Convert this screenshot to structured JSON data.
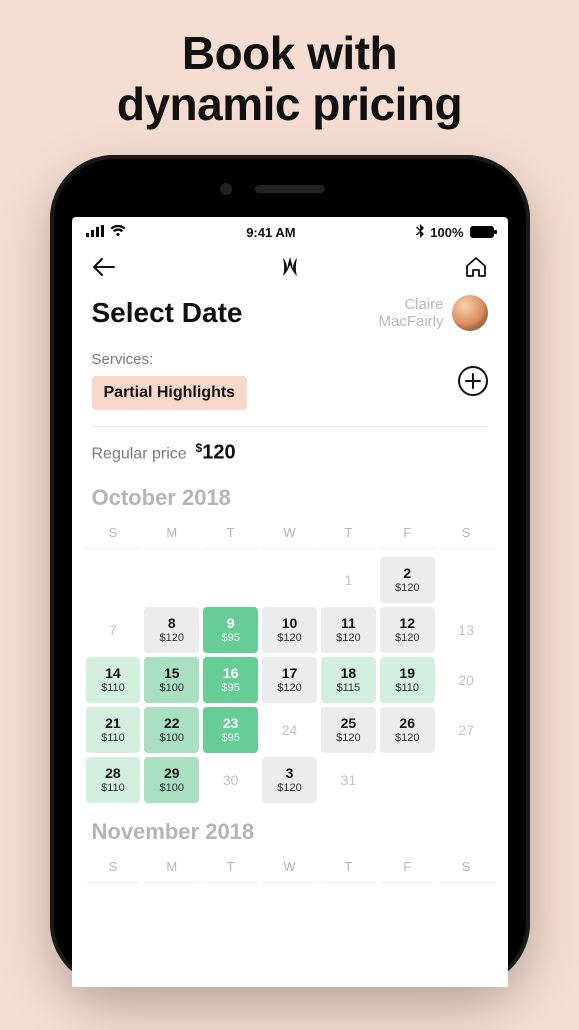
{
  "promo": {
    "line1": "Book with",
    "line2": "dynamic pricing"
  },
  "statusbar": {
    "time": "9:41 AM",
    "battery_pct": "100%"
  },
  "page": {
    "title": "Select Date",
    "user_first": "Claire",
    "user_last": "MacFairly"
  },
  "services": {
    "label": "Services:",
    "chip": "Partial Highlights"
  },
  "price": {
    "label": "Regular price",
    "currency": "$",
    "amount": "120"
  },
  "dow": [
    "S",
    "M",
    "T",
    "W",
    "T",
    "F",
    "S"
  ],
  "months": {
    "oct": {
      "title": "October 2018"
    },
    "nov": {
      "title": "November 2018"
    }
  },
  "oct_grid": [
    {
      "t": "empty"
    },
    {
      "t": "empty"
    },
    {
      "t": "empty"
    },
    {
      "t": "empty"
    },
    {
      "t": "dis",
      "d": "1"
    },
    {
      "t": "gray",
      "d": "2",
      "p": "$120"
    },
    {
      "t": "empty"
    },
    {
      "t": "dis",
      "d": "7"
    },
    {
      "t": "gray",
      "d": "8",
      "p": "$120"
    },
    {
      "t": "g3",
      "d": "9",
      "p": "$95"
    },
    {
      "t": "gray",
      "d": "10",
      "p": "$120"
    },
    {
      "t": "gray",
      "d": "11",
      "p": "$120"
    },
    {
      "t": "gray",
      "d": "12",
      "p": "$120"
    },
    {
      "t": "dis",
      "d": "13"
    },
    {
      "t": "g1",
      "d": "14",
      "p": "$110"
    },
    {
      "t": "g2",
      "d": "15",
      "p": "$100"
    },
    {
      "t": "g3",
      "d": "16",
      "p": "$95"
    },
    {
      "t": "gray",
      "d": "17",
      "p": "$120"
    },
    {
      "t": "g1",
      "d": "18",
      "p": "$115"
    },
    {
      "t": "g1",
      "d": "19",
      "p": "$110"
    },
    {
      "t": "dis",
      "d": "20"
    },
    {
      "t": "g1",
      "d": "21",
      "p": "$110"
    },
    {
      "t": "g2",
      "d": "22",
      "p": "$100"
    },
    {
      "t": "g3",
      "d": "23",
      "p": "$95"
    },
    {
      "t": "dis",
      "d": "24"
    },
    {
      "t": "gray",
      "d": "25",
      "p": "$120"
    },
    {
      "t": "gray",
      "d": "26",
      "p": "$120"
    },
    {
      "t": "dis",
      "d": "27"
    },
    {
      "t": "g1",
      "d": "28",
      "p": "$110"
    },
    {
      "t": "g2",
      "d": "29",
      "p": "$100"
    },
    {
      "t": "dis",
      "d": "30"
    },
    {
      "t": "gray",
      "d": "3",
      "p": "$120"
    },
    {
      "t": "dis",
      "d": "31"
    },
    {
      "t": "empty"
    },
    {
      "t": "empty"
    }
  ]
}
